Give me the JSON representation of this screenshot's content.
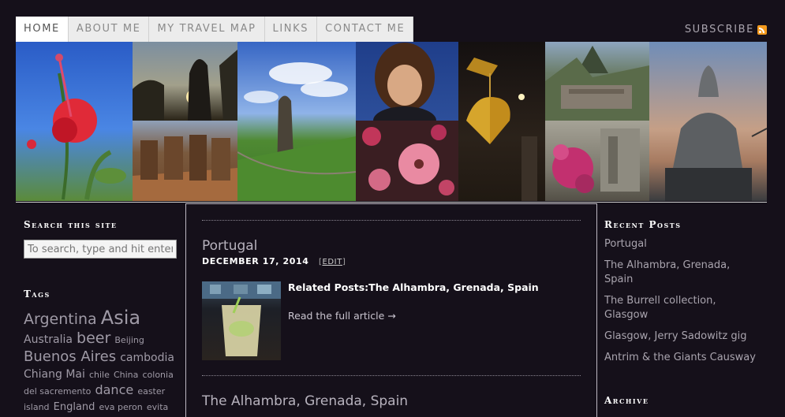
{
  "nav": {
    "items": [
      {
        "label": "HOME"
      },
      {
        "label": "ABOUT ME"
      },
      {
        "label": "MY TRAVEL MAP"
      },
      {
        "label": "LINKS"
      },
      {
        "label": "CONTACT ME"
      }
    ],
    "subscribe_label": "SUBSCRIBE",
    "rss_icon": "rss-icon"
  },
  "sidebar_left": {
    "search_heading": "Search this site",
    "search_placeholder": "To search, type and hit enter",
    "tags_heading": "Tags",
    "tags": [
      {
        "text": "Argentina"
      },
      {
        "text": "Asia"
      },
      {
        "text": "Australia"
      },
      {
        "text": "beer"
      },
      {
        "text": "Beijing"
      },
      {
        "text": "Buenos Aires"
      },
      {
        "text": "cambodia"
      },
      {
        "text": "Chiang Mai"
      },
      {
        "text": "chile"
      },
      {
        "text": "China"
      },
      {
        "text": "colonia"
      },
      {
        "text": "del sacremento"
      },
      {
        "text": "dance"
      },
      {
        "text": "easter"
      },
      {
        "text": "island"
      },
      {
        "text": "England"
      },
      {
        "text": "eva peron"
      },
      {
        "text": "evita"
      }
    ]
  },
  "main": {
    "posts": [
      {
        "title": "Portugal",
        "date": "DECEMBER 17, 2014",
        "edit_label": "EDIT",
        "related": "Related Posts:The Alhambra, Grenada, Spain",
        "read_more": "Read the full article →"
      },
      {
        "title": "The Alhambra, Grenada, Spain"
      }
    ]
  },
  "sidebar_right": {
    "recent_heading": "Recent Posts",
    "recent": [
      "Portugal",
      "The Alhambra, Grenada, Spain",
      "The Burrell collection, Glasgow",
      "Glasgow, Jerry Sadowitz gig",
      "Antrim & the Giants Causway"
    ],
    "archive_heading": "Archive"
  },
  "colors": {
    "background": "#15101a",
    "nav_bg": "#ececec",
    "rss": "#f39a1e"
  }
}
